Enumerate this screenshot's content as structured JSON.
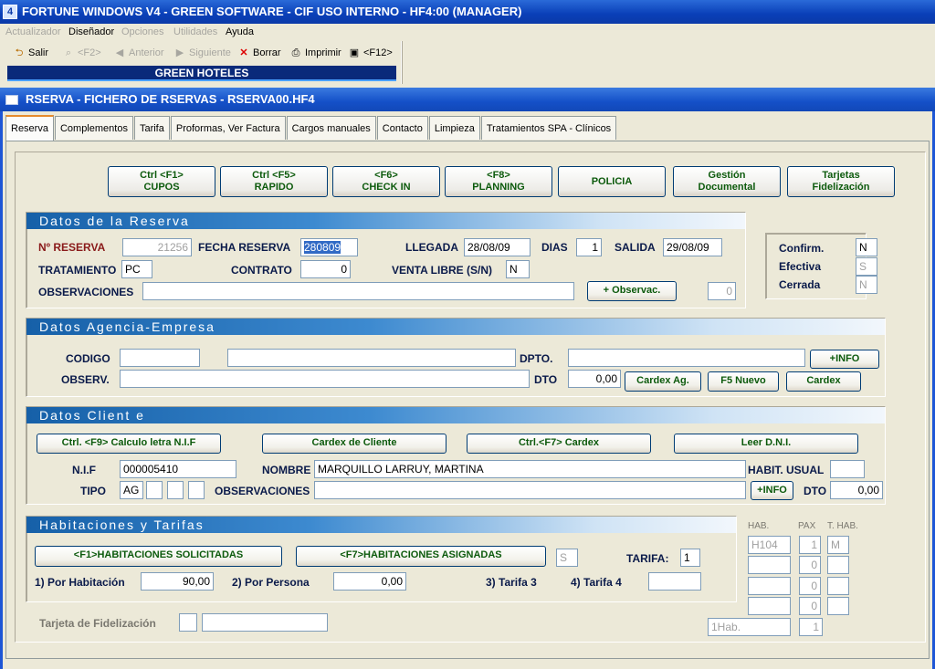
{
  "window": {
    "title": "FORTUNE WINDOWS V4 - GREEN SOFTWARE - CIF USO INTERNO - HF4:00 (MANAGER)",
    "icon": "4"
  },
  "menu": [
    "Actualizador",
    "Diseñador",
    "Opciones",
    "Utilidades",
    "Ayuda"
  ],
  "toolbar": {
    "salir": "Salir",
    "f2": "<F2>",
    "anterior": "Anterior",
    "siguiente": "Siguiente",
    "borrar": "Borrar",
    "imprimir": "Imprimir",
    "f12": "<F12>",
    "company": "GREEN HOTELES"
  },
  "doc": {
    "title": "RSERVA  -  FICHERO DE RSERVAS  -  RSERVA00.HF4"
  },
  "tabs": [
    "Reserva",
    "Complementos",
    "Tarifa",
    "Proformas, Ver Factura",
    "Cargos manuales",
    "Contacto",
    "Limpieza",
    "Tratamientos SPA - Clínicos"
  ],
  "actions": {
    "cupos": {
      "l1": "Ctrl <F1>",
      "l2": "CUPOS"
    },
    "rapido": {
      "l1": "Ctrl <F5>",
      "l2": "RAPIDO"
    },
    "checkin": {
      "l1": "<F6>",
      "l2": "CHECK IN"
    },
    "planning": {
      "l1": "<F8>",
      "l2": "PLANNING"
    },
    "policia": {
      "l1": "POLICIA"
    },
    "gestion": {
      "l1": "Gestión",
      "l2": "Documental"
    },
    "tarjetas": {
      "l1": "Tarjetas",
      "l2": "Fidelización"
    }
  },
  "reserva": {
    "heading": "Datos de la Reserva",
    "no_reserva_label": "Nº RESERVA",
    "no_reserva": "21256",
    "fecha_label": "FECHA RESERVA",
    "fecha": "280809",
    "llegada_label": "LLEGADA",
    "llegada": "28/08/09",
    "dias_label": "DIAS",
    "dias": "1",
    "salida_label": "SALIDA",
    "salida": "29/08/09",
    "tratamiento_label": "TRATAMIENTO",
    "tratamiento": "PC",
    "contrato_label": "CONTRATO",
    "contrato": "0",
    "venta_label": "VENTA LIBRE (S/N)",
    "venta": "N",
    "obs_label": "OBSERVACIONES",
    "obs": "",
    "obs_btn": "+ Observac.",
    "obs_count": "0"
  },
  "status": {
    "confirm_label": "Confirm.",
    "confirm": "N",
    "efectiva_label": "Efectiva",
    "efectiva": "S",
    "cerrada_label": "Cerrada",
    "cerrada": "N"
  },
  "agencia": {
    "heading": "Datos Agencia-Empresa",
    "codigo_label": "CODIGO",
    "observ_label": "OBSERV.",
    "dpto_label": "DPTO.",
    "dto_label": "DTO",
    "dto": "0,00",
    "info_btn": "+INFO",
    "cardex_ag": "Cardex Ag.",
    "f5nuevo": "F5 Nuevo",
    "cardex": "Cardex"
  },
  "cliente": {
    "heading": "Datos Client e",
    "btn_nif": "Ctrl. <F9> Calculo letra N.I.F",
    "btn_cardex_cliente": "Cardex de Cliente",
    "btn_cardex_f7": "Ctrl.<F7> Cardex",
    "btn_dni": "Leer D.N.I.",
    "nif_label": "N.I.F",
    "nif": "000005410",
    "nombre_label": "NOMBRE",
    "nombre": "MARQUILLO LARRUY, MARTINA",
    "habit_label": "HABIT. USUAL",
    "tipo_label": "TIPO",
    "tipo": "AG",
    "obs_label": "OBSERVACIONES",
    "info_btn": "+INFO",
    "dto_label": "DTO",
    "dto": "0,00"
  },
  "habitaciones": {
    "heading": "Habitaciones y Tarifas",
    "btn_solicitadas": "<F1>HABITACIONES SOLICITADAS",
    "btn_asignadas": "<F7>HABITACIONES ASIGNADAS",
    "s_value": "S",
    "tarifa_label": "TARIFA:",
    "tarifa": "1",
    "por_hab_label": "1) Por Habitación",
    "por_hab": "90,00",
    "por_persona_label": "2) Por Persona",
    "por_persona": "0,00",
    "tarifa3_label": "3) Tarifa 3",
    "tarifa4_label": "4) Tarifa 4",
    "col_hab": "HAB.",
    "col_pax": "PAX",
    "col_thab": "T. HAB.",
    "rows": [
      {
        "hab": "H104",
        "pax": "1",
        "thab": "M"
      },
      {
        "hab": "",
        "pax": "0",
        "thab": ""
      },
      {
        "hab": "",
        "pax": "0",
        "thab": ""
      },
      {
        "hab": "",
        "pax": "0",
        "thab": ""
      }
    ],
    "total_hab": "1Hab.",
    "total_pax": "1"
  },
  "fidelizacion": {
    "label": "Tarjeta de Fidelización"
  }
}
